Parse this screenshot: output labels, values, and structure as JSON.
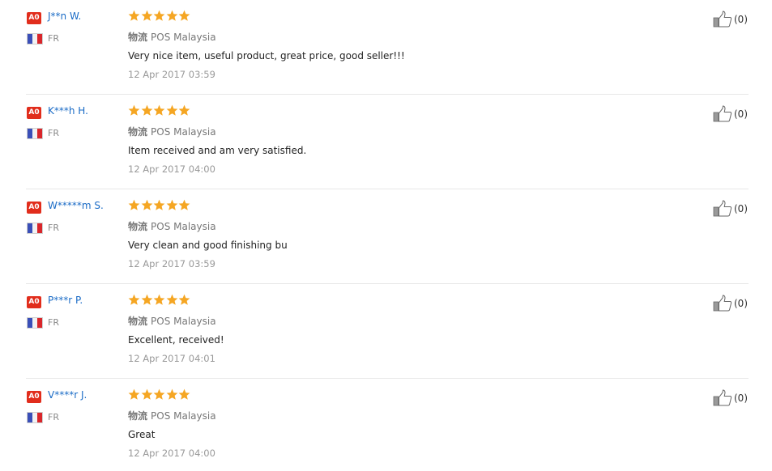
{
  "colors": {
    "badge": "#e12d1c",
    "username": "#1a6bc6",
    "star": "#f5a623",
    "divider": "#e8e8e8"
  },
  "icons": {
    "rating_star": "star-icon",
    "helpful": "thumbs-up-icon",
    "country": "france-flag-icon"
  },
  "reviews": [
    {
      "level": "A0",
      "user": "J**n W.",
      "country": "FR",
      "rating": 5,
      "logistics_label": "物流",
      "logistics": "POS Malaysia",
      "text": "Very nice item, useful product, great price, good seller!!!",
      "date": "12 Apr 2017 03:59",
      "helpful": "(0)"
    },
    {
      "level": "A0",
      "user": "K***h H.",
      "country": "FR",
      "rating": 5,
      "logistics_label": "物流",
      "logistics": "POS Malaysia",
      "text": "Item received and am very satisfied.",
      "date": "12 Apr 2017 04:00",
      "helpful": "(0)"
    },
    {
      "level": "A0",
      "user": "W*****m S.",
      "country": "FR",
      "rating": 5,
      "logistics_label": "物流",
      "logistics": "POS Malaysia",
      "text": "Very clean and good finishing bu",
      "date": "12 Apr 2017 03:59",
      "helpful": "(0)"
    },
    {
      "level": "A0",
      "user": "P***r P.",
      "country": "FR",
      "rating": 5,
      "logistics_label": "物流",
      "logistics": "POS Malaysia",
      "text": "Excellent, received!",
      "date": "12 Apr 2017 04:01",
      "helpful": "(0)"
    },
    {
      "level": "A0",
      "user": "V****r J.",
      "country": "FR",
      "rating": 5,
      "logistics_label": "物流",
      "logistics": "POS Malaysia",
      "text": "Great",
      "date": "12 Apr 2017 04:00",
      "helpful": "(0)"
    }
  ]
}
